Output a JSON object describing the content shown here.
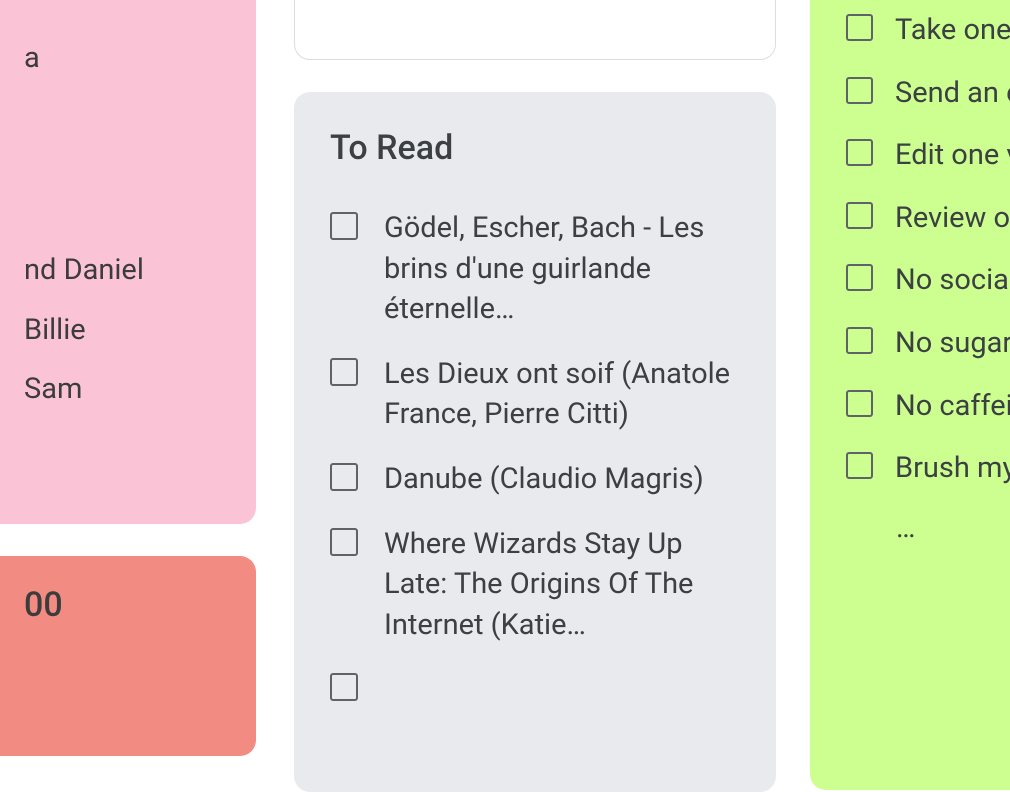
{
  "pinkCard": {
    "names": [
      "nd Daniel",
      "Billie",
      "Sam"
    ],
    "partialName": "a"
  },
  "orangeCard": {
    "num": "00"
  },
  "grayCard": {
    "title": "To Read",
    "items": [
      "Gödel, Escher, Bach - Les brins d'une guirlande éternelle…",
      "Les Dieux ont soif (Anatole France, Pierre Citti)",
      "Danube (Claudio Magris)",
      "Where Wizards Stay Up Late: The Origins Of The Internet (Katie…"
    ]
  },
  "greenCard": {
    "items": [
      "Take one proper ca",
      "Send an e to one fri",
      "Edit one v per day",
      "Review o",
      "No socia",
      "No sugar",
      "No caffei",
      "Brush my morning"
    ],
    "ellipsis": "…"
  }
}
